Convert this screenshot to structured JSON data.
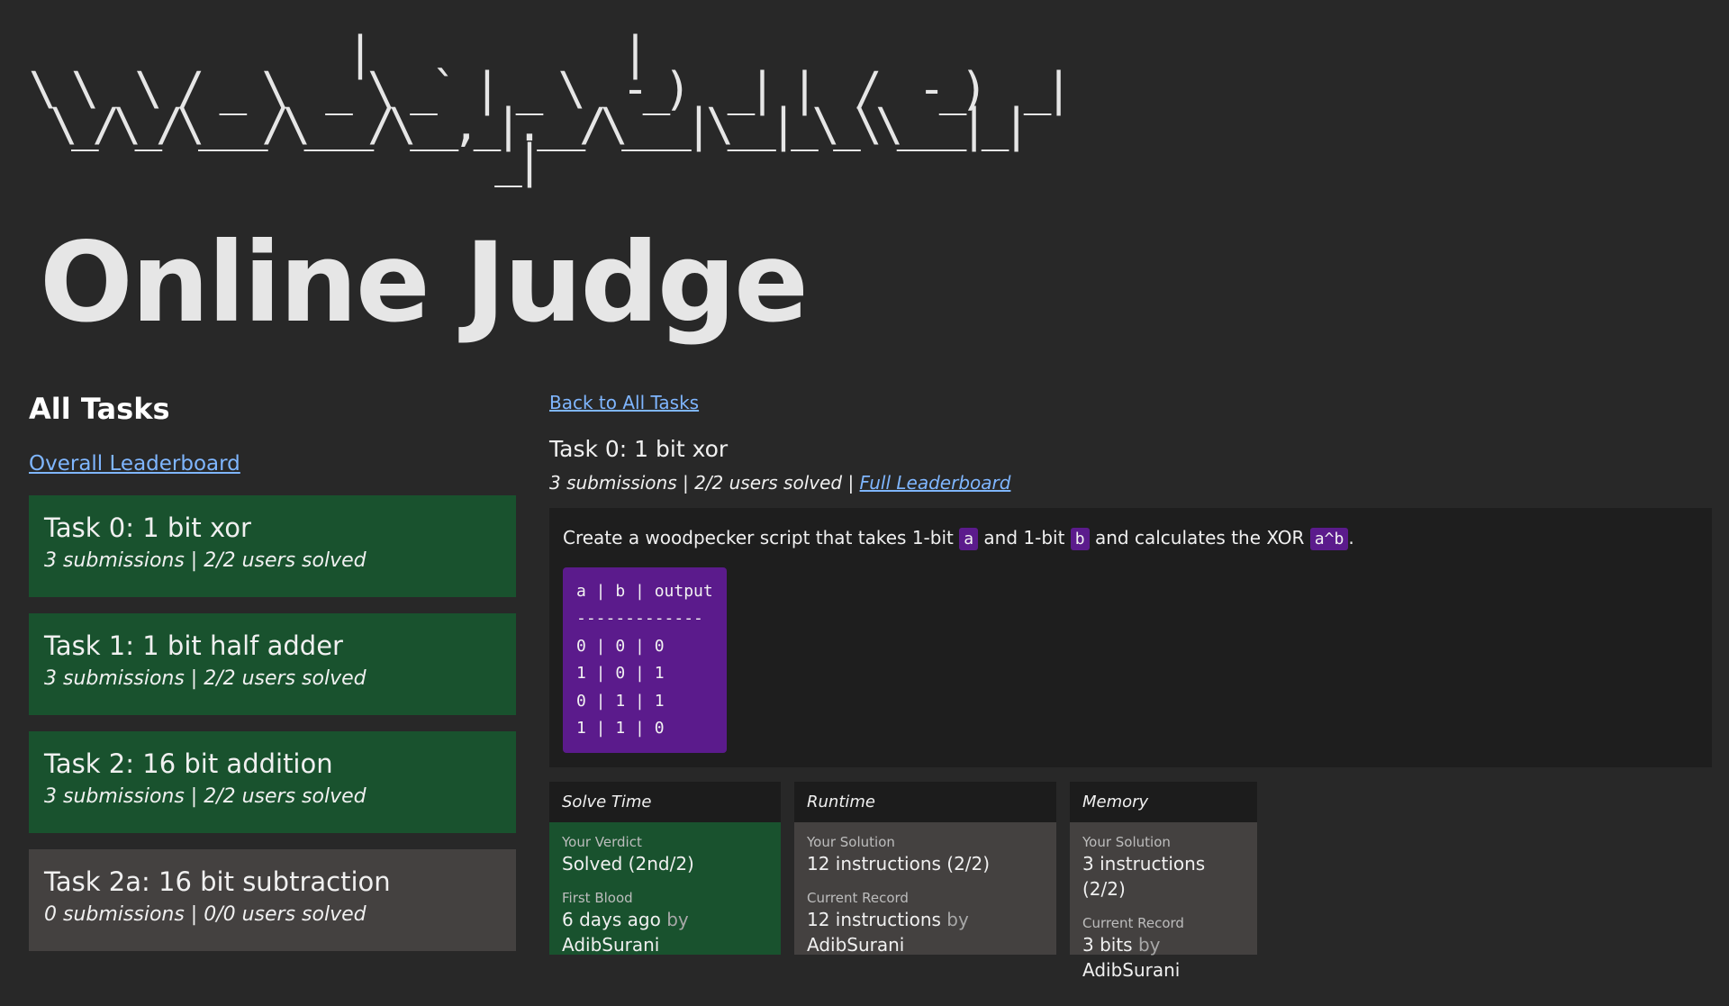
{
  "brand": {
    "ascii_art": "               |            |\n\\ \\  \\ / _ \\  _ \\ _` | _ \\  -_)  _| |  /  -_)  _|\n \\_/\\_/\\___/\\___/\\__,_|.__/\\___|\\__|_\\_\\\\___|_|\n                      _|",
    "title": "Online Judge"
  },
  "sidebar": {
    "heading": "All Tasks",
    "leaderboard_link": "Overall Leaderboard",
    "tasks": [
      {
        "title": "Task 0: 1 bit xor",
        "meta": "3 submissions | 2/2 users solved",
        "solved": true
      },
      {
        "title": "Task 1: 1 bit half adder",
        "meta": "3 submissions | 2/2 users solved",
        "solved": true
      },
      {
        "title": "Task 2: 16 bit addition",
        "meta": "3 submissions | 2/2 users solved",
        "solved": true
      },
      {
        "title": "Task 2a: 16 bit subtraction",
        "meta": "0 submissions | 0/0 users solved",
        "solved": false
      }
    ]
  },
  "main": {
    "back_link": "Back to All Tasks",
    "task_title": "Task 0: 1 bit xor",
    "stats_text": "3 submissions | 2/2 users solved | ",
    "full_leaderboard_link": "Full Leaderboard",
    "description": {
      "part1": "Create a woodpecker script that takes 1-bit ",
      "code_a": "a",
      "part2": " and 1-bit ",
      "code_b": "b",
      "part3": " and calculates the XOR ",
      "code_xor": "a^b",
      "part4": "."
    },
    "truth_table": {
      "header": "a | b | output",
      "separator": "-------------",
      "rows": [
        "0 | 0 | 0",
        "1 | 0 | 1",
        "0 | 1 | 1",
        "1 | 1 | 0"
      ]
    },
    "stat_cards": {
      "solve_time": {
        "header": "Solve Time",
        "label1": "Your Verdict",
        "value1": "Solved (2nd/2)",
        "label2": "First Blood",
        "value2": "6 days ago",
        "by": "by",
        "user2": "AdibSurani"
      },
      "runtime": {
        "header": "Runtime",
        "label1": "Your Solution",
        "value1": "12 instructions (2/2)",
        "label2": "Current Record",
        "value2": "12 instructions",
        "by": "by",
        "user2": "AdibSurani"
      },
      "memory": {
        "header": "Memory",
        "label1": "Your Solution",
        "value1": "3 instructions (2/2)",
        "label2": "Current Record",
        "value2": "3 bits",
        "by": "by",
        "user2": "AdibSurani"
      }
    }
  },
  "colors": {
    "background": "#282828",
    "solved_green": "#19522e",
    "unsolved_gray": "#444140",
    "code_purple": "#5b1b8c",
    "link_blue": "#7fb6ff"
  }
}
